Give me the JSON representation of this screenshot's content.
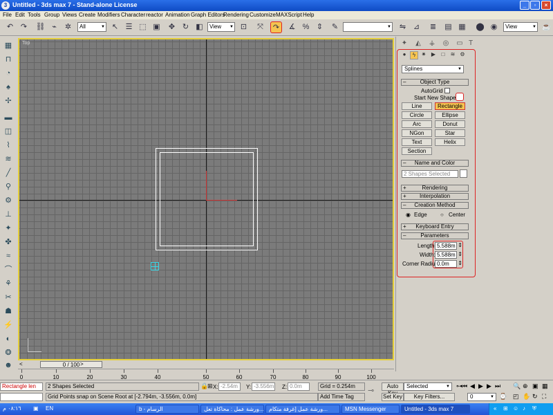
{
  "window": {
    "title": "Untitled - 3ds max 7 - Stand-alone License"
  },
  "menu": [
    "File",
    "Edit",
    "Tools",
    "Group",
    "Views",
    "Create",
    "Modifiers",
    "Character",
    "reactor",
    "Animation",
    "Graph Editors",
    "Rendering",
    "Customize",
    "MAXScript",
    "Help"
  ],
  "toolbar": {
    "selection_filter": "All",
    "ref_coord": "View",
    "named_sel": "",
    "render_view": "View"
  },
  "viewport": {
    "label": "Top"
  },
  "time": {
    "slider": "0 / 100"
  },
  "ruler": [
    "0",
    "10",
    "20",
    "30",
    "40",
    "50",
    "60",
    "70",
    "80",
    "90",
    "100"
  ],
  "command_panel": {
    "category": "Splines",
    "object_type": "Object Type",
    "autogrid": "AutoGrid",
    "start_new_shape": "Start New Shape",
    "buttons": [
      "Line",
      "Rectangle",
      "Circle",
      "Ellipse",
      "Arc",
      "Donut",
      "NGon",
      "Star",
      "Text",
      "Helix",
      "Section"
    ],
    "name_and_color": "Name and Color",
    "name_value": "2 Shapes Selected",
    "rendering": "Rendering",
    "interpolation": "Interpolation",
    "creation_method": "Creation Method",
    "edge": "Edge",
    "center": "Center",
    "keyboard_entry": "Keyboard Entry",
    "parameters": "Parameters",
    "length_label": "Length:",
    "length": "5.588m",
    "width_label": "Width:",
    "width": "5.588m",
    "corner_label": "Corner Radius:",
    "corner": "0.0m",
    "accent": "#f5c451"
  },
  "status": {
    "maxscript": "Rectangle len",
    "selected": "2 Shapes Selected",
    "prompt": "Grid Points snap on Scene Root at [-2.794m, -3.556m, 0.0m]",
    "x_label": "X:",
    "x": "-2.54m",
    "y_label": "Y:",
    "y": "-3.556m",
    "z_label": "Z:",
    "z": "0.0m",
    "grid": "Grid = 0.254m",
    "add_time_tag": "Add Time Tag",
    "auto_key": "Auto Key",
    "set_key": "Set Key",
    "key_mode": "Selected",
    "key_filters": "Key Filters...",
    "frame": "0"
  },
  "taskbar": {
    "lang": "EN",
    "tasks": [
      "b - الرسام",
      "ورشة عمل : محاكاة تعل...",
      "ورشة عمل [غرفة متكام...",
      "MSN Messenger",
      "Untitled - 3ds max 7"
    ],
    "clock": "٠٨:١٦ م"
  }
}
